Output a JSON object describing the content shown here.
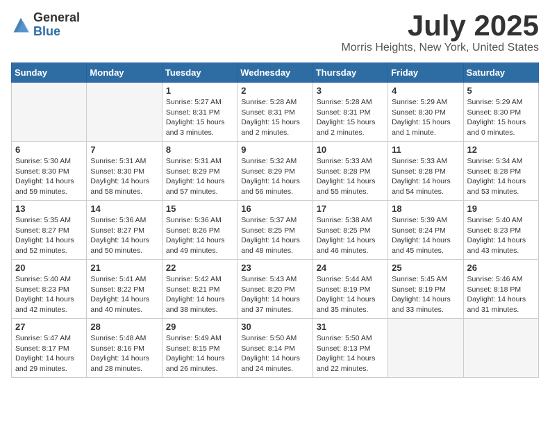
{
  "header": {
    "logo_general": "General",
    "logo_blue": "Blue",
    "month_title": "July 2025",
    "location": "Morris Heights, New York, United States"
  },
  "days_of_week": [
    "Sunday",
    "Monday",
    "Tuesday",
    "Wednesday",
    "Thursday",
    "Friday",
    "Saturday"
  ],
  "weeks": [
    [
      {
        "day": "",
        "empty": true
      },
      {
        "day": "",
        "empty": true
      },
      {
        "day": "1",
        "sunrise": "Sunrise: 5:27 AM",
        "sunset": "Sunset: 8:31 PM",
        "daylight": "Daylight: 15 hours and 3 minutes."
      },
      {
        "day": "2",
        "sunrise": "Sunrise: 5:28 AM",
        "sunset": "Sunset: 8:31 PM",
        "daylight": "Daylight: 15 hours and 2 minutes."
      },
      {
        "day": "3",
        "sunrise": "Sunrise: 5:28 AM",
        "sunset": "Sunset: 8:31 PM",
        "daylight": "Daylight: 15 hours and 2 minutes."
      },
      {
        "day": "4",
        "sunrise": "Sunrise: 5:29 AM",
        "sunset": "Sunset: 8:30 PM",
        "daylight": "Daylight: 15 hours and 1 minute."
      },
      {
        "day": "5",
        "sunrise": "Sunrise: 5:29 AM",
        "sunset": "Sunset: 8:30 PM",
        "daylight": "Daylight: 15 hours and 0 minutes."
      }
    ],
    [
      {
        "day": "6",
        "sunrise": "Sunrise: 5:30 AM",
        "sunset": "Sunset: 8:30 PM",
        "daylight": "Daylight: 14 hours and 59 minutes."
      },
      {
        "day": "7",
        "sunrise": "Sunrise: 5:31 AM",
        "sunset": "Sunset: 8:30 PM",
        "daylight": "Daylight: 14 hours and 58 minutes."
      },
      {
        "day": "8",
        "sunrise": "Sunrise: 5:31 AM",
        "sunset": "Sunset: 8:29 PM",
        "daylight": "Daylight: 14 hours and 57 minutes."
      },
      {
        "day": "9",
        "sunrise": "Sunrise: 5:32 AM",
        "sunset": "Sunset: 8:29 PM",
        "daylight": "Daylight: 14 hours and 56 minutes."
      },
      {
        "day": "10",
        "sunrise": "Sunrise: 5:33 AM",
        "sunset": "Sunset: 8:28 PM",
        "daylight": "Daylight: 14 hours and 55 minutes."
      },
      {
        "day": "11",
        "sunrise": "Sunrise: 5:33 AM",
        "sunset": "Sunset: 8:28 PM",
        "daylight": "Daylight: 14 hours and 54 minutes."
      },
      {
        "day": "12",
        "sunrise": "Sunrise: 5:34 AM",
        "sunset": "Sunset: 8:28 PM",
        "daylight": "Daylight: 14 hours and 53 minutes."
      }
    ],
    [
      {
        "day": "13",
        "sunrise": "Sunrise: 5:35 AM",
        "sunset": "Sunset: 8:27 PM",
        "daylight": "Daylight: 14 hours and 52 minutes."
      },
      {
        "day": "14",
        "sunrise": "Sunrise: 5:36 AM",
        "sunset": "Sunset: 8:27 PM",
        "daylight": "Daylight: 14 hours and 50 minutes."
      },
      {
        "day": "15",
        "sunrise": "Sunrise: 5:36 AM",
        "sunset": "Sunset: 8:26 PM",
        "daylight": "Daylight: 14 hours and 49 minutes."
      },
      {
        "day": "16",
        "sunrise": "Sunrise: 5:37 AM",
        "sunset": "Sunset: 8:25 PM",
        "daylight": "Daylight: 14 hours and 48 minutes."
      },
      {
        "day": "17",
        "sunrise": "Sunrise: 5:38 AM",
        "sunset": "Sunset: 8:25 PM",
        "daylight": "Daylight: 14 hours and 46 minutes."
      },
      {
        "day": "18",
        "sunrise": "Sunrise: 5:39 AM",
        "sunset": "Sunset: 8:24 PM",
        "daylight": "Daylight: 14 hours and 45 minutes."
      },
      {
        "day": "19",
        "sunrise": "Sunrise: 5:40 AM",
        "sunset": "Sunset: 8:23 PM",
        "daylight": "Daylight: 14 hours and 43 minutes."
      }
    ],
    [
      {
        "day": "20",
        "sunrise": "Sunrise: 5:40 AM",
        "sunset": "Sunset: 8:23 PM",
        "daylight": "Daylight: 14 hours and 42 minutes."
      },
      {
        "day": "21",
        "sunrise": "Sunrise: 5:41 AM",
        "sunset": "Sunset: 8:22 PM",
        "daylight": "Daylight: 14 hours and 40 minutes."
      },
      {
        "day": "22",
        "sunrise": "Sunrise: 5:42 AM",
        "sunset": "Sunset: 8:21 PM",
        "daylight": "Daylight: 14 hours and 38 minutes."
      },
      {
        "day": "23",
        "sunrise": "Sunrise: 5:43 AM",
        "sunset": "Sunset: 8:20 PM",
        "daylight": "Daylight: 14 hours and 37 minutes."
      },
      {
        "day": "24",
        "sunrise": "Sunrise: 5:44 AM",
        "sunset": "Sunset: 8:19 PM",
        "daylight": "Daylight: 14 hours and 35 minutes."
      },
      {
        "day": "25",
        "sunrise": "Sunrise: 5:45 AM",
        "sunset": "Sunset: 8:19 PM",
        "daylight": "Daylight: 14 hours and 33 minutes."
      },
      {
        "day": "26",
        "sunrise": "Sunrise: 5:46 AM",
        "sunset": "Sunset: 8:18 PM",
        "daylight": "Daylight: 14 hours and 31 minutes."
      }
    ],
    [
      {
        "day": "27",
        "sunrise": "Sunrise: 5:47 AM",
        "sunset": "Sunset: 8:17 PM",
        "daylight": "Daylight: 14 hours and 29 minutes."
      },
      {
        "day": "28",
        "sunrise": "Sunrise: 5:48 AM",
        "sunset": "Sunset: 8:16 PM",
        "daylight": "Daylight: 14 hours and 28 minutes."
      },
      {
        "day": "29",
        "sunrise": "Sunrise: 5:49 AM",
        "sunset": "Sunset: 8:15 PM",
        "daylight": "Daylight: 14 hours and 26 minutes."
      },
      {
        "day": "30",
        "sunrise": "Sunrise: 5:50 AM",
        "sunset": "Sunset: 8:14 PM",
        "daylight": "Daylight: 14 hours and 24 minutes."
      },
      {
        "day": "31",
        "sunrise": "Sunrise: 5:50 AM",
        "sunset": "Sunset: 8:13 PM",
        "daylight": "Daylight: 14 hours and 22 minutes."
      },
      {
        "day": "",
        "empty": true
      },
      {
        "day": "",
        "empty": true
      }
    ]
  ]
}
